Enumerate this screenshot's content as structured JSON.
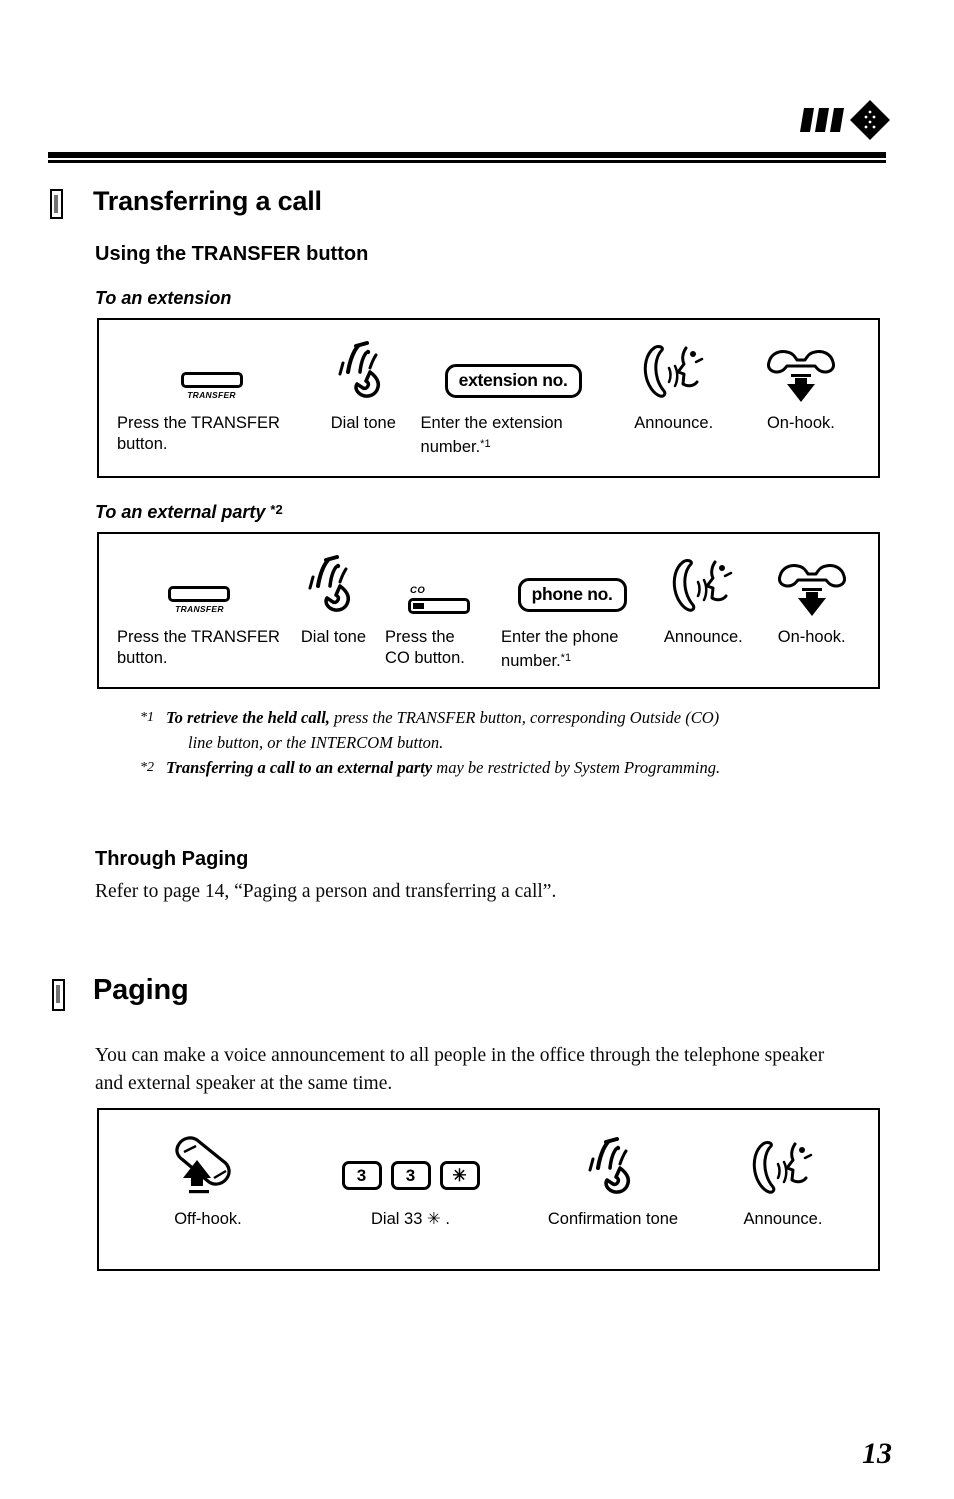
{
  "page": {
    "number": "13",
    "header_icon": "forward-arrow-icon"
  },
  "sections": [
    {
      "id": "transferring",
      "title": "Transferring a call",
      "marker": "section-marker-icon",
      "subheading": "Using the TRANSFER button",
      "procedures": [
        {
          "id": "to-an-extension",
          "heading": "To an extension",
          "footnote_ref": "",
          "steps": [
            {
              "art": "transfer-button-icon",
              "art_label": "TRANSFER",
              "label": "Press the TRANSFER\nbutton."
            },
            {
              "art": "dial-tone-icon",
              "label": "Dial tone"
            },
            {
              "art": "extension-no-pill",
              "pill": "extension no.",
              "label": "Enter the extension\nnumber.",
              "sup": "*1"
            },
            {
              "art": "announce-icon",
              "label": "Announce."
            },
            {
              "art": "on-hook-icon",
              "label": "On-hook."
            }
          ]
        },
        {
          "id": "to-an-external-party",
          "heading": "To an external party",
          "footnote_ref": "*2",
          "steps": [
            {
              "art": "transfer-button-icon",
              "art_label": "TRANSFER",
              "label": "Press the TRANSFER\nbutton."
            },
            {
              "art": "dial-tone-icon",
              "label": "Dial tone"
            },
            {
              "art": "co-button-icon",
              "art_label": "CO",
              "label": "Press the\nCO button."
            },
            {
              "art": "phone-no-pill",
              "pill": "phone no.",
              "label": "Enter the phone\nnumber.",
              "sup": "*1"
            },
            {
              "art": "announce-icon",
              "label": "Announce."
            },
            {
              "art": "on-hook-icon",
              "label": "On-hook."
            }
          ]
        }
      ],
      "footnotes": [
        {
          "mark": "*1",
          "bold": "To retrieve the held call,",
          "rest": " press the TRANSFER button, corresponding Outside (CO)",
          "cont": "line button, or the INTERCOM button."
        },
        {
          "mark": "*2",
          "bold": "Transferring a call to an external party",
          "rest": " may be restricted by System Programming.",
          "cont": ""
        }
      ],
      "through_paging": {
        "heading": "Through Paging",
        "text": "Refer to page 14, “Paging a person and transferring a call”."
      }
    },
    {
      "id": "paging",
      "title": "Paging",
      "marker": "section-marker-icon",
      "intro": "You can make a voice announcement to all people in the office through the telephone speaker and external speaker at the same time.",
      "procedure": {
        "id": "paging-steps",
        "steps": [
          {
            "art": "off-hook-icon",
            "label": "Off-hook."
          },
          {
            "art": "dial-keys",
            "keys": [
              "3",
              "3",
              "✳"
            ],
            "label": "Dial 33 ✳ ."
          },
          {
            "art": "dial-tone-icon",
            "label": "Confirmation tone"
          },
          {
            "art": "announce-icon",
            "label": "Announce."
          }
        ]
      }
    }
  ]
}
